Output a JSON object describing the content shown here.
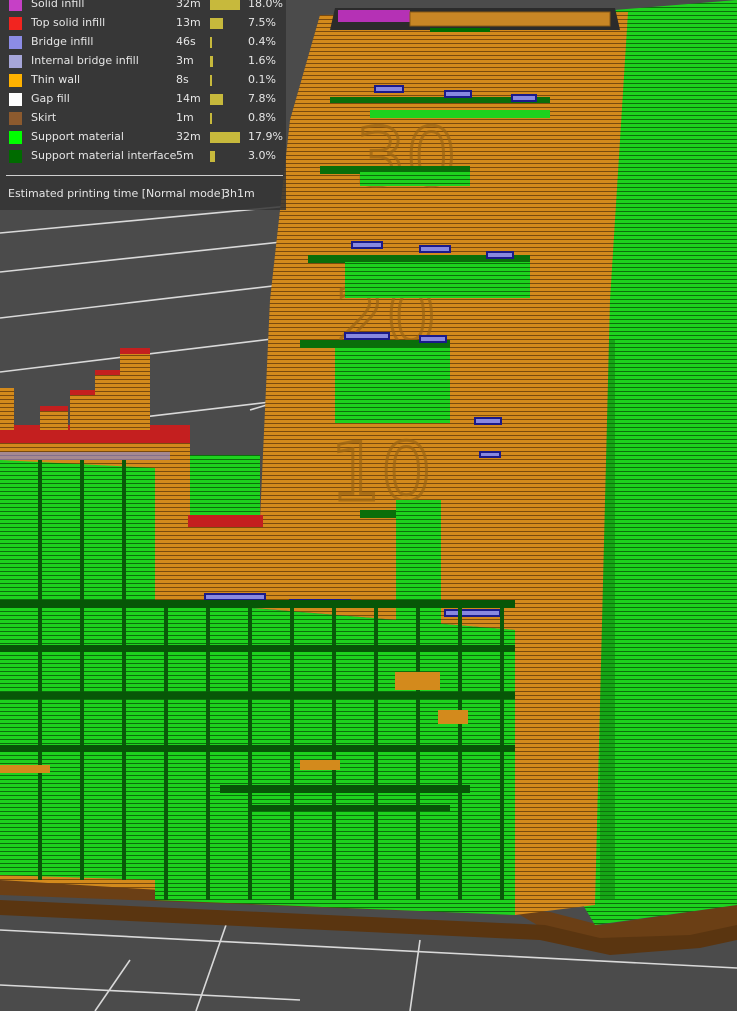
{
  "legend": {
    "items": [
      {
        "label": "Solid infill",
        "time": "32m",
        "percent": "18.0%",
        "fraction": 0.18,
        "color": "#c640c6"
      },
      {
        "label": "Top solid infill",
        "time": "13m",
        "percent": "7.5%",
        "fraction": 0.075,
        "color": "#f2241f"
      },
      {
        "label": "Bridge infill",
        "time": "46s",
        "percent": "0.4%",
        "fraction": 0.004,
        "color": "#8c8ce6"
      },
      {
        "label": "Internal bridge infill",
        "time": "3m",
        "percent": "1.6%",
        "fraction": 0.016,
        "color": "#a6a6d9"
      },
      {
        "label": "Thin wall",
        "time": "8s",
        "percent": "0.1%",
        "fraction": 0.001,
        "color": "#ffb200"
      },
      {
        "label": "Gap fill",
        "time": "14m",
        "percent": "7.8%",
        "fraction": 0.078,
        "color": "#ffffff"
      },
      {
        "label": "Skirt",
        "time": "1m",
        "percent": "0.8%",
        "fraction": 0.008,
        "color": "#8c5a2e"
      },
      {
        "label": "Support material",
        "time": "32m",
        "percent": "17.9%",
        "fraction": 0.179,
        "color": "#00ff00"
      },
      {
        "label": "Support material interface",
        "time": "5m",
        "percent": "3.0%",
        "fraction": 0.03,
        "color": "#006b00"
      }
    ],
    "estimated_label": "Estimated printing time [Normal mode]:",
    "estimated_value": "3h1m"
  }
}
